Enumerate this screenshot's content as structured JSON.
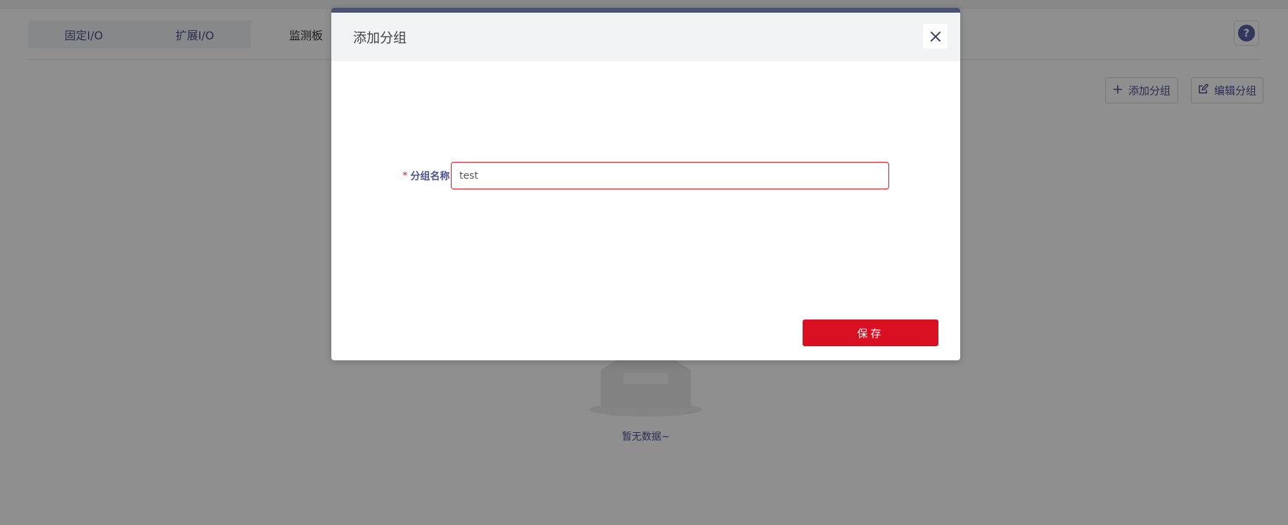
{
  "tabs": [
    {
      "label": "固定I/O"
    },
    {
      "label": "扩展I/O"
    },
    {
      "label": "监测板"
    }
  ],
  "help": {
    "label": "?"
  },
  "actions": {
    "add_group": "添加分组",
    "edit_group": "编辑分组"
  },
  "empty": {
    "text": "暂无数据~"
  },
  "modal": {
    "title": "添加分组",
    "field": {
      "required_mark": "*",
      "label": "分组名称:",
      "value": "test"
    },
    "save_label": "保存"
  },
  "colors": {
    "accent": "#d90f22",
    "brand": "#4a5390",
    "overlay": "#000000"
  },
  "icons": {
    "close": "close-icon",
    "help": "question-icon",
    "add": "plus-icon",
    "edit": "edit-icon"
  }
}
